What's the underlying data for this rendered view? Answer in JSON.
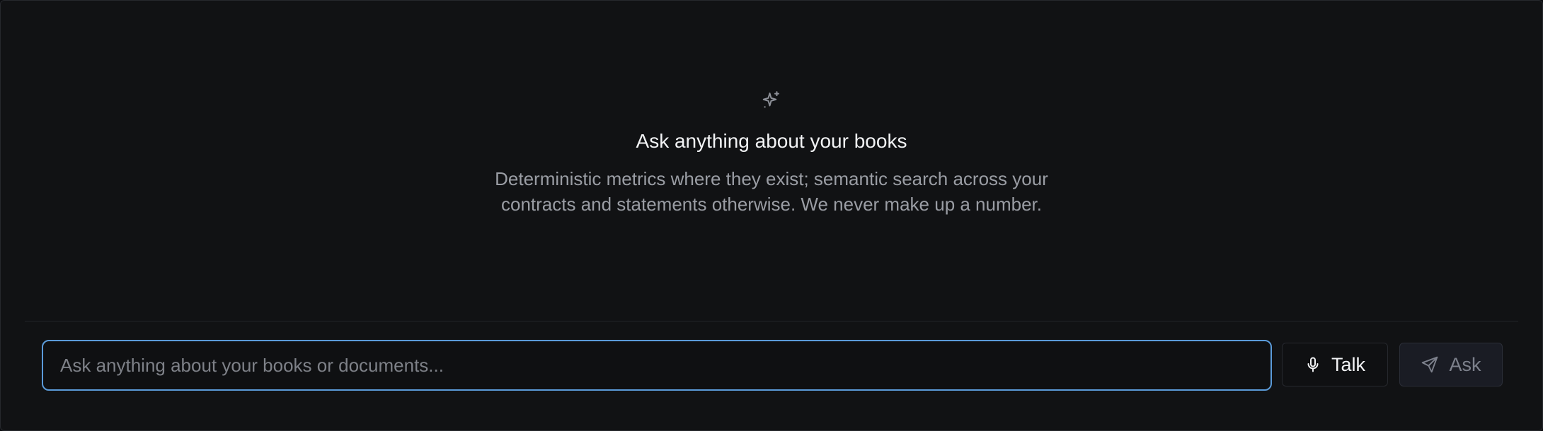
{
  "empty_state": {
    "icon": "sparkles-icon",
    "title": "Ask anything about your books",
    "subtitle": "Deterministic metrics where they exist; semantic search across your contracts and statements otherwise. We never make up a number."
  },
  "composer": {
    "input_value": "",
    "input_placeholder": "Ask anything about your books or documents...",
    "talk_label": "Talk",
    "talk_icon": "microphone-icon",
    "ask_label": "Ask",
    "ask_icon": "send-icon"
  },
  "colors": {
    "background": "#111214",
    "focus_border": "#5b9bd9",
    "muted_text": "#9a9da4",
    "title_text": "#f2f3f5"
  }
}
